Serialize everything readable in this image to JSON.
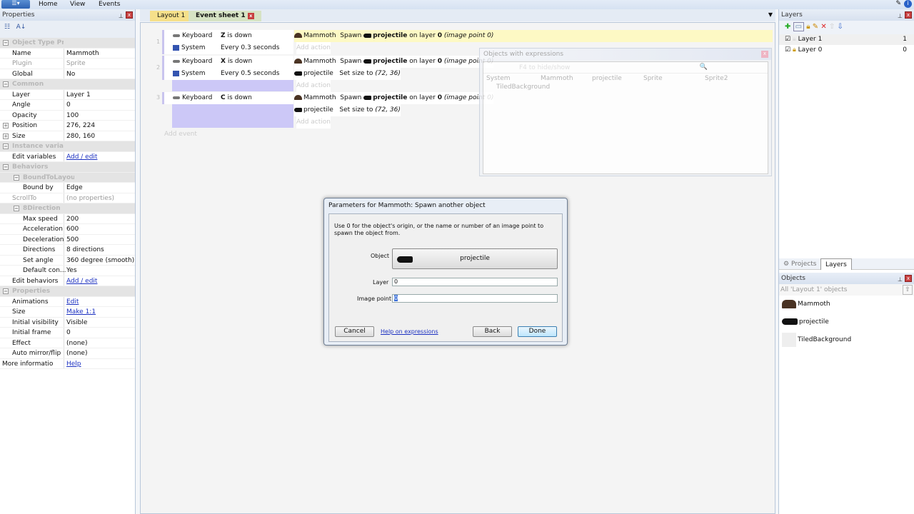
{
  "ribbon": {
    "tabs": [
      "Home",
      "View",
      "Events"
    ]
  },
  "properties": {
    "title": "Properties",
    "rows": [
      {
        "t": "h",
        "n": "Object Type Properties"
      },
      {
        "n": "Name",
        "v": "Mammoth"
      },
      {
        "n": "Plugin",
        "v": "Sprite",
        "dim": true
      },
      {
        "n": "Global",
        "v": "No"
      },
      {
        "t": "h",
        "n": "Common"
      },
      {
        "n": "Layer",
        "v": "Layer 1"
      },
      {
        "n": "Angle",
        "v": "0"
      },
      {
        "n": "Opacity",
        "v": "100"
      },
      {
        "n": "Position",
        "v": "276, 224",
        "plus": true
      },
      {
        "n": "Size",
        "v": "280, 160",
        "plus": true
      },
      {
        "t": "h",
        "n": "Instance variables"
      },
      {
        "n": "Edit variables",
        "v": "Add / edit",
        "link": true
      },
      {
        "t": "h",
        "n": "Behaviors"
      },
      {
        "t": "h",
        "n": "BoundToLayout",
        "i": 1
      },
      {
        "n": "Bound by",
        "v": "Edge",
        "i": 2
      },
      {
        "n": "ScrollTo",
        "v": "(no properties)",
        "dim": true
      },
      {
        "t": "h",
        "n": "8Direction",
        "i": 1
      },
      {
        "n": "Max speed",
        "v": "200",
        "i": 2
      },
      {
        "n": "Acceleration",
        "v": "600",
        "i": 2
      },
      {
        "n": "Deceleration",
        "v": "500",
        "i": 2
      },
      {
        "n": "Directions",
        "v": "8 directions",
        "i": 2
      },
      {
        "n": "Set angle",
        "v": "360 degree (smooth)",
        "i": 2
      },
      {
        "n": "Default con...",
        "v": "Yes",
        "i": 2
      },
      {
        "n": "Edit behaviors",
        "v": "Add / edit",
        "link": true
      },
      {
        "t": "h",
        "n": "Properties"
      },
      {
        "n": "Animations",
        "v": "Edit",
        "link": true
      },
      {
        "n": "Size",
        "v": "Make 1:1",
        "link": true
      },
      {
        "n": "Initial visibility",
        "v": "Visible"
      },
      {
        "n": "Initial frame",
        "v": "0"
      },
      {
        "n": "Effect",
        "v": "(none)"
      },
      {
        "n": "Auto mirror/flip",
        "v": "(none)"
      },
      {
        "n": "More information",
        "v": "Help",
        "link": true,
        "root": true
      }
    ]
  },
  "tabs": {
    "layout": "Layout 1",
    "sheet": "Event sheet 1"
  },
  "events": {
    "add_action": "Add action",
    "add_event": "Add event",
    "e1": {
      "num": "1",
      "c1o": "Keyboard",
      "c1": "Z is down",
      "c2o": "System",
      "c2": "Every 0.3 seconds"
    },
    "e2": {
      "num": "2",
      "c1o": "Keyboard",
      "c1": "X is down",
      "c2o": "System",
      "c2": "Every 0.5 seconds"
    },
    "e3": {
      "num": "3",
      "c1o": "Keyboard",
      "c1": "C is down"
    },
    "spawn": {
      "obj": "Mammoth",
      "verb": "Spawn",
      "target": "projectile",
      "mid": "on layer",
      "layer": "0",
      "ip": "(image point 0)"
    },
    "setsize": {
      "obj": "projectile",
      "text": "Set size to",
      "val": "(72, 36)"
    }
  },
  "owe": {
    "title": "Objects with expressions",
    "hint": "F4 to hide/show",
    "items": [
      "System",
      "Mammoth",
      "projectile",
      "Sprite",
      "Sprite2",
      "TiledBackground"
    ]
  },
  "dialog": {
    "title": "Parameters for Mammoth: Spawn another object",
    "desc": "Use 0 for the object's origin, or the name or number of an image point to spawn the object from.",
    "object_label": "Object",
    "object_value": "projectile",
    "layer_label": "Layer",
    "layer_value": "0",
    "ip_label": "Image point",
    "ip_value": "0",
    "cancel": "Cancel",
    "help": "Help on expressions",
    "back": "Back",
    "done": "Done"
  },
  "layers": {
    "title": "Layers",
    "items": [
      {
        "name": "Layer 1",
        "n": "1"
      },
      {
        "name": "Layer 0",
        "n": "0"
      }
    ]
  },
  "bottomtabs": {
    "projects": "Projects",
    "layers": "Layers"
  },
  "objects": {
    "title": "Objects",
    "filter": "All 'Layout 1' objects",
    "items": [
      "Mammoth",
      "projectile",
      "TiledBackground"
    ]
  }
}
